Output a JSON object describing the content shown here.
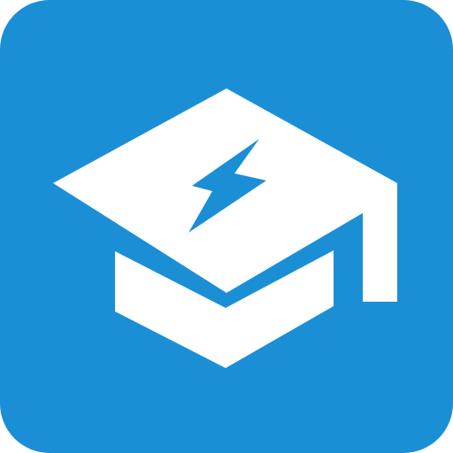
{
  "app_icon": {
    "icon_name": "graduation-cap-lightning-icon",
    "colors": {
      "background": "#1A8FD6",
      "foreground": "#FFFFFF"
    }
  }
}
